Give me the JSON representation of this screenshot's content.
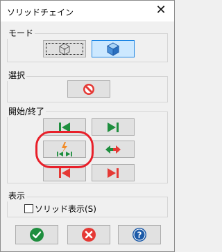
{
  "window": {
    "title": "ソリッドチェイン",
    "close_glyph": "✕"
  },
  "mode": {
    "label": "モード",
    "buttons": [
      {
        "name": "wireframe-cube",
        "pressed": false
      },
      {
        "name": "solid-cube",
        "pressed": true
      }
    ]
  },
  "select": {
    "label": "選択"
  },
  "start_end": {
    "label": "開始/終了"
  },
  "display": {
    "label": "表示",
    "solid_display_label": "ソリッド表示(S)",
    "solid_display_checked": false
  },
  "colors": {
    "accent_green": "#1e8e3e",
    "accent_red": "#e53935",
    "accent_orange": "#f28c28",
    "accent_blue": "#1c5aa8",
    "highlight_ring": "#e8202a"
  },
  "icons": {
    "ok": "checkmark-icon",
    "cancel": "x-circle-icon",
    "help": "question-mark-icon"
  }
}
